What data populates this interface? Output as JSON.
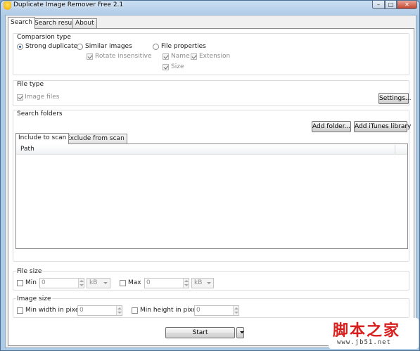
{
  "window": {
    "title": "Duplicate Image Remover Free 2.1",
    "controls": {
      "minimize": "–",
      "maximize": "□",
      "close": "✕"
    }
  },
  "tabs": [
    {
      "label": "Search",
      "active": true
    },
    {
      "label": "Search result",
      "active": false
    },
    {
      "label": "About",
      "active": false
    }
  ],
  "comparison": {
    "title": "Comparsion type",
    "strong": "Strong duplicate",
    "similar": "Similar images",
    "rotate": "Rotate insensitive",
    "file_props": "File properties",
    "name": "Name",
    "extension": "Extension",
    "size": "Size"
  },
  "file_type": {
    "title": "File type",
    "image_files": "Image files",
    "settings_button": "Settings..."
  },
  "search_folders": {
    "title": "Search folders",
    "add_folder": "Add folder...",
    "add_itunes": "Add iTunes library",
    "include_tab": "Include to scan",
    "exclude_tab": "Exclude from scan",
    "path_header": "Path"
  },
  "file_size": {
    "title": "File size",
    "min_label": "Min",
    "min_value": "0",
    "min_unit": "kB",
    "max_label": "Max",
    "max_value": "0",
    "max_unit": "kB"
  },
  "image_size": {
    "title": "Image size",
    "min_width_label": "Min width in pixel",
    "min_width_value": "0",
    "min_height_label": "Min height in pixel",
    "min_height_value": "0"
  },
  "actions": {
    "start": "Start"
  },
  "watermark": {
    "text": "脚本之家",
    "url": "www.jb51.net"
  },
  "colors": {
    "titlebar": "#b8d1ea",
    "close_button": "#c4462f",
    "watermark": "#d8201e"
  }
}
